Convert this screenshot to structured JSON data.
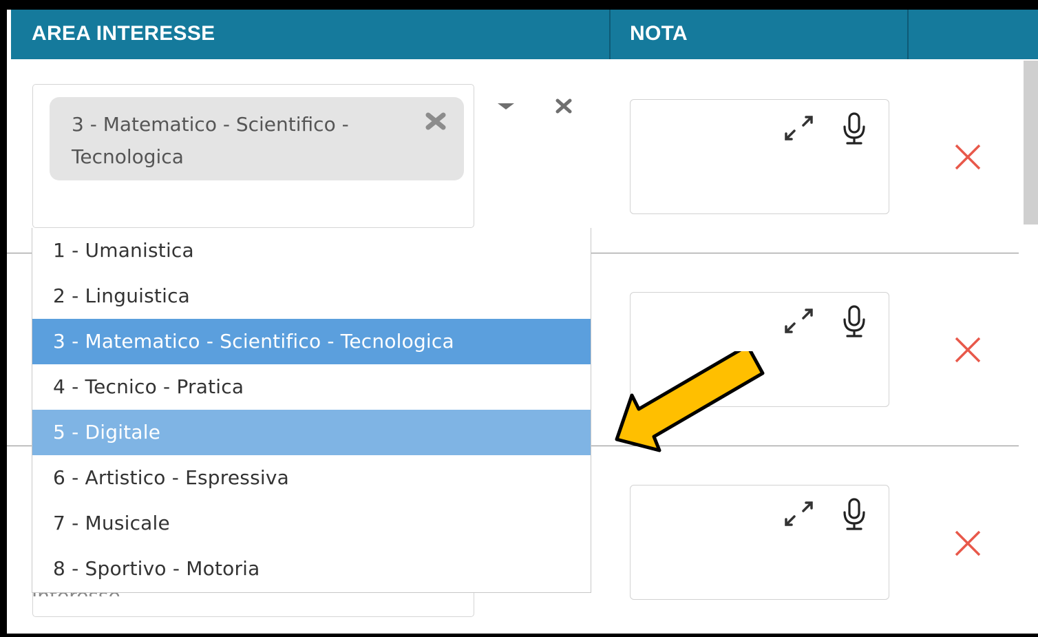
{
  "header": {
    "col_area": "AREA INTERESSE",
    "col_nota": "NOTA"
  },
  "row1": {
    "selected_chip": "3 - Matematico - Scientifico - Tecnologica"
  },
  "row3": {
    "placeholder_fragment": "Interesse"
  },
  "dropdown": {
    "options": [
      {
        "label": "1 - Umanistica",
        "state": "normal"
      },
      {
        "label": "2 - Linguistica",
        "state": "normal"
      },
      {
        "label": "3 - Matematico - Scientifico - Tecnologica",
        "state": "selected"
      },
      {
        "label": "4 - Tecnico - Pratica",
        "state": "normal"
      },
      {
        "label": "5 - Digitale",
        "state": "hover"
      },
      {
        "label": "6 - Artistico - Espressiva",
        "state": "normal"
      },
      {
        "label": "7 - Musicale",
        "state": "normal"
      },
      {
        "label": "8 - Sportivo - Motoria",
        "state": "normal"
      }
    ]
  },
  "icons": {
    "chip_remove": "close-icon",
    "dropdown_caret": "caret-down-icon",
    "clear_selection": "close-icon",
    "note_expand": "expand-icon",
    "note_dictate": "microphone-icon",
    "row_delete": "close-icon",
    "annotation": "arrow-pointer"
  },
  "colors": {
    "header_bg": "#157a9c",
    "option_selected": "#5b9fdd",
    "option_hover": "#7fb4e4",
    "delete_x": "#e8584a",
    "annotation_arrow": "#ffbf00"
  }
}
